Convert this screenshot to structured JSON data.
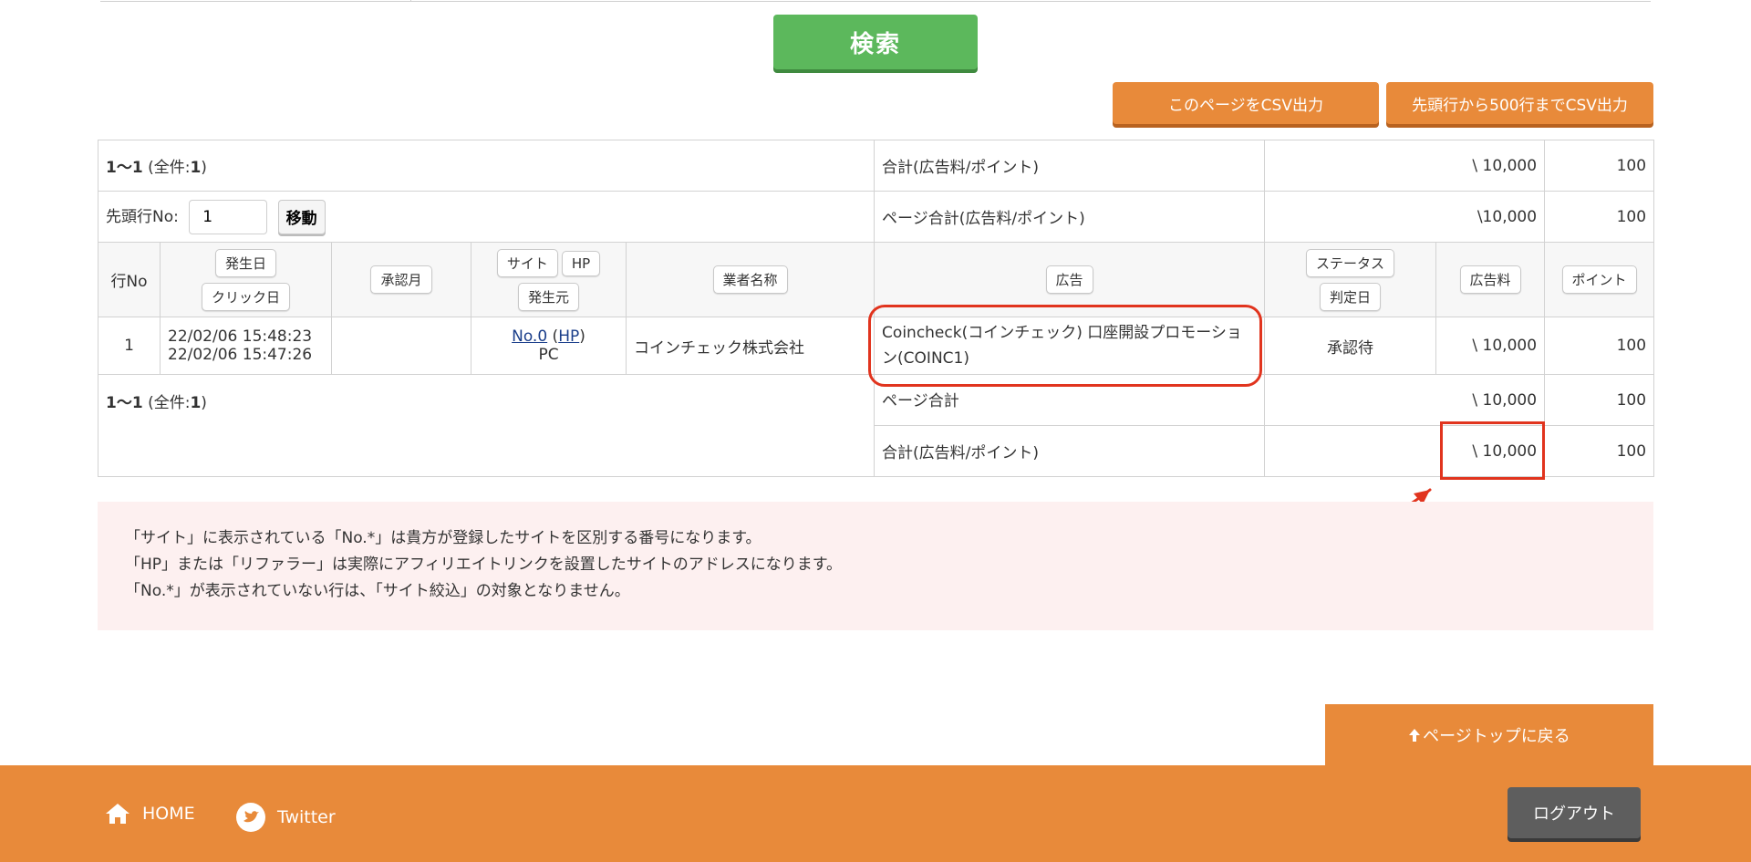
{
  "search": {
    "button_label": "検索"
  },
  "csv": {
    "page_label": "このページをCSV出力",
    "head500_label": "先頭行から500行までCSV出力"
  },
  "summary_top": {
    "range_bold": "1〜1",
    "count_prefix": "(全件:",
    "count": "1",
    "count_suffix": ")",
    "total_label": "合計(広告料/ポイント)",
    "total_fee": "\\ 10,000",
    "total_points": "100",
    "start_row_label": "先頭行No:",
    "start_row_value": "1",
    "move_label": "移動",
    "page_total_label": "ページ合計(広告料/ポイント)",
    "page_total_fee": "\\10,000",
    "page_total_points": "100"
  },
  "headers": {
    "row_no": "行No",
    "occurred_date": "発生日",
    "click_date": "クリック日",
    "approval_month": "承認月",
    "site": "サイト",
    "hp": "HP",
    "source": "発生元",
    "merchant": "業者名称",
    "ad": "広告",
    "status": "ステータス",
    "judged_date": "判定日",
    "ad_fee": "広告料",
    "points": "ポイント"
  },
  "rows": [
    {
      "row_no": "1",
      "occurred_at": "22/02/06 15:48:23",
      "clicked_at": "22/02/06 15:47:26",
      "approval_month": "",
      "site_no": "No.0",
      "hp_link": "HP",
      "source": "PC",
      "merchant": "コインチェック株式会社",
      "ad": "Coincheck(コインチェック) 口座開設プロモーション(COINC1)",
      "status": "承認待",
      "ad_fee": "\\ 10,000",
      "points": "100"
    }
  ],
  "summary_bottom": {
    "range_bold": "1〜1",
    "count_prefix": "(全件:",
    "count": "1",
    "count_suffix": ")",
    "page_total_label": "ページ合計",
    "page_total_fee": "\\ 10,000",
    "page_total_points": "100",
    "total_label": "合計(広告料/ポイント)",
    "total_fee": "\\ 10,000",
    "total_points": "100"
  },
  "notes": [
    "「サイト」に表示されている「No.*」は貴方が登録したサイトを区別する番号になります。",
    "「HP」または「リファラー」は実際にアフィリエイトリンクを設置したサイトのアドレスになります。",
    "「No.*」が表示されていない行は、「サイト絞込」の対象となりません。"
  ],
  "page_top": {
    "label": "ページトップに戻る",
    "icon": "arrow-up-icon"
  },
  "footer": {
    "home_label": "HOME",
    "home_icon": "home-icon",
    "twitter_label": "Twitter",
    "twitter_icon": "twitter-icon",
    "logout_label": "ログアウト"
  },
  "colors": {
    "accent_orange": "#e88a3a",
    "search_green": "#5cb85c",
    "annotation_red": "#e1341e",
    "note_bg": "#fdf0f0",
    "logout_gray": "#5e5e5e"
  }
}
